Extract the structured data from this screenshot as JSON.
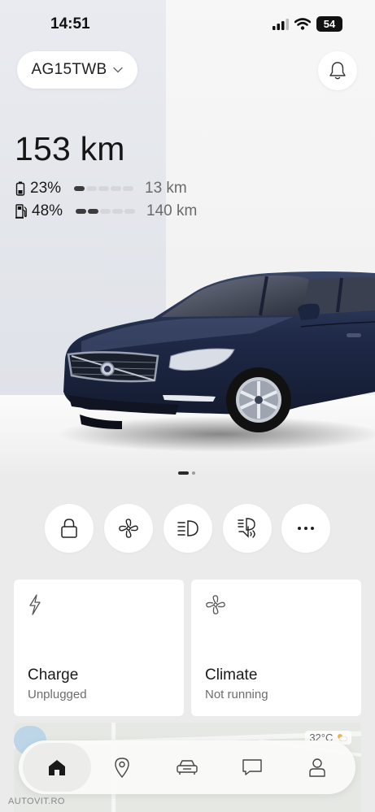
{
  "status_bar": {
    "time": "14:51",
    "battery": "54"
  },
  "vehicle": {
    "plate": "AG15TWB",
    "total_range": "153 km",
    "battery": {
      "percent": "23%",
      "level_fraction": 0.23,
      "range": "13 km",
      "icon": "battery-icon"
    },
    "fuel": {
      "percent": "48%",
      "level_fraction": 0.48,
      "range": "140 km",
      "icon": "fuel-pump-icon"
    }
  },
  "pager": {
    "pages": 2,
    "active": 0
  },
  "quick_actions": [
    {
      "name": "lock-button",
      "icon": "lock-icon"
    },
    {
      "name": "climate-fan-button",
      "icon": "fan-icon"
    },
    {
      "name": "headlights-button",
      "icon": "headlight-icon"
    },
    {
      "name": "horn-lights-button",
      "icon": "horn-lights-icon"
    },
    {
      "name": "more-button",
      "icon": "more-dots-icon",
      "label": "···"
    }
  ],
  "cards": {
    "charge": {
      "title": "Charge",
      "subtitle": "Unplugged",
      "icon": "lightning-icon"
    },
    "climate": {
      "title": "Climate",
      "subtitle": "Not running",
      "icon": "fan-icon"
    }
  },
  "map": {
    "weather": "32°C"
  },
  "bottom_nav": {
    "items": [
      {
        "name": "nav-home",
        "icon": "home-icon",
        "active": true
      },
      {
        "name": "nav-map",
        "icon": "location-pin-icon",
        "active": false
      },
      {
        "name": "nav-car",
        "icon": "car-icon",
        "active": false
      },
      {
        "name": "nav-messages",
        "icon": "chat-icon",
        "active": false
      },
      {
        "name": "nav-profile",
        "icon": "profile-icon",
        "active": false
      }
    ]
  },
  "watermark": "AUTOVIT.RO",
  "colors": {
    "background": "#ebebeb",
    "card": "#ffffff",
    "car_body": "#1e2a4a",
    "level_on": "#3c3c3c",
    "level_off": "#d4d6da"
  }
}
